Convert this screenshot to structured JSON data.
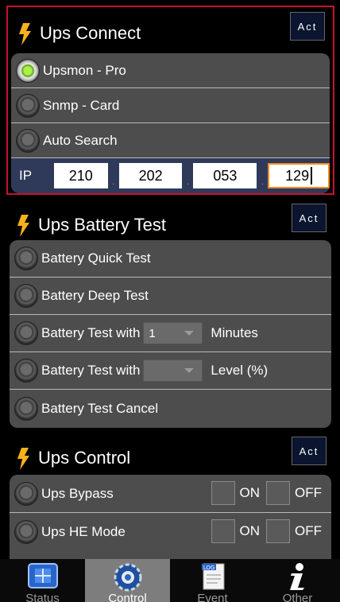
{
  "connect": {
    "title": "Ups Connect",
    "act": "Act",
    "options": [
      "Upsmon - Pro",
      "Snmp - Card",
      "Auto Search"
    ],
    "selected": 0,
    "ip_label": "IP",
    "ip": [
      "210",
      "202",
      "053",
      "129"
    ],
    "ip_sep": "."
  },
  "battery": {
    "title": "Ups Battery Test",
    "act": "Act",
    "quick": "Battery Quick Test",
    "deep": "Battery Deep Test",
    "with_minutes_prefix": "Battery Test with",
    "minutes_value": "1",
    "minutes_suffix": "Minutes",
    "with_level_prefix": "Battery Test with",
    "level_value": "",
    "level_suffix": "Level (%)",
    "cancel": "Battery Test Cancel"
  },
  "control": {
    "title": "Ups Control",
    "act": "Act",
    "bypass": "Ups Bypass",
    "he_mode": "Ups HE Mode",
    "on": "ON",
    "off": "OFF"
  },
  "nav": {
    "items": [
      "Status",
      "Control",
      "Event",
      "Other"
    ],
    "active": 1,
    "event_badge": "LOG"
  },
  "colors": {
    "accent_bolt": "#f5b21b",
    "frame_red": "#c8102e",
    "panel": "#4d4d4d",
    "ip_focus": "#f08a1c"
  }
}
